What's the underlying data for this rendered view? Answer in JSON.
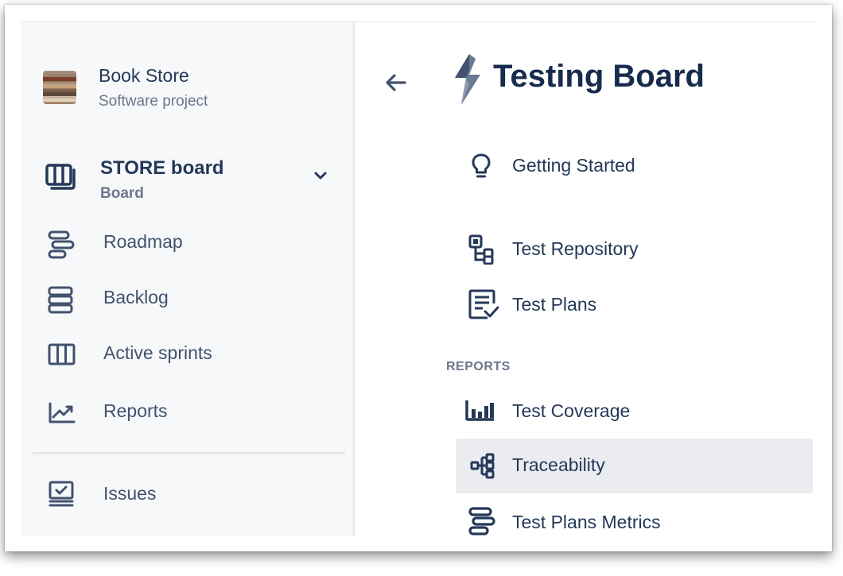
{
  "project": {
    "name": "Book Store",
    "type": "Software project"
  },
  "sidebar": {
    "board": {
      "name": "STORE board",
      "sub": "Board"
    },
    "items": [
      {
        "label": "Roadmap",
        "icon": "roadmap-icon"
      },
      {
        "label": "Backlog",
        "icon": "backlog-icon"
      },
      {
        "label": "Active sprints",
        "icon": "active-sprints-icon"
      },
      {
        "label": "Reports",
        "icon": "reports-icon"
      },
      {
        "label": "Issues",
        "icon": "issues-icon"
      }
    ]
  },
  "panel": {
    "title": "Testing Board",
    "items": [
      {
        "label": "Getting Started",
        "icon": "lightbulb-icon"
      },
      {
        "label": "Test Repository",
        "icon": "test-repository-icon"
      },
      {
        "label": "Test Plans",
        "icon": "test-plans-icon"
      }
    ],
    "reports_section": "REPORTS",
    "reports": [
      {
        "label": "Test Coverage",
        "icon": "test-coverage-icon"
      },
      {
        "label": "Traceability",
        "icon": "traceability-icon",
        "selected": true
      },
      {
        "label": "Test Plans Metrics",
        "icon": "test-plans-metrics-icon"
      }
    ]
  },
  "colors": {
    "text_primary": "#253858",
    "text_secondary": "#6b778c",
    "icon": "#42526e",
    "selected_bg": "#ebecf0",
    "sidebar_bg": "#f7f8fa"
  }
}
